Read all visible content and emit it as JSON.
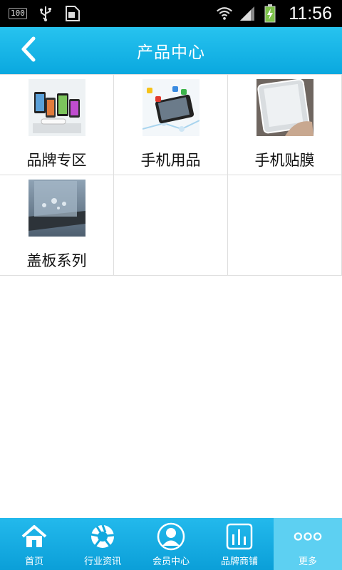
{
  "status_bar": {
    "battery_level": "100",
    "time": "11:56"
  },
  "header": {
    "title": "产品中心"
  },
  "products": [
    {
      "label": "品牌专区",
      "icon": "brand-phones-image"
    },
    {
      "label": "手机用品",
      "icon": "phone-accessories-image"
    },
    {
      "label": "手机贴膜",
      "icon": "screen-protector-image"
    },
    {
      "label": "盖板系列",
      "icon": "cover-glass-image"
    }
  ],
  "tabs": [
    {
      "label": "首页",
      "icon": "home-icon"
    },
    {
      "label": "行业资讯",
      "icon": "aperture-icon"
    },
    {
      "label": "会员中心",
      "icon": "member-icon"
    },
    {
      "label": "品牌商铺",
      "icon": "store-icon"
    },
    {
      "label": "更多",
      "icon": "more-icon"
    }
  ],
  "colors": {
    "header": "#0aa8df",
    "tabbar": "#0b9fd8",
    "active_tab": "#5dd0f2"
  }
}
